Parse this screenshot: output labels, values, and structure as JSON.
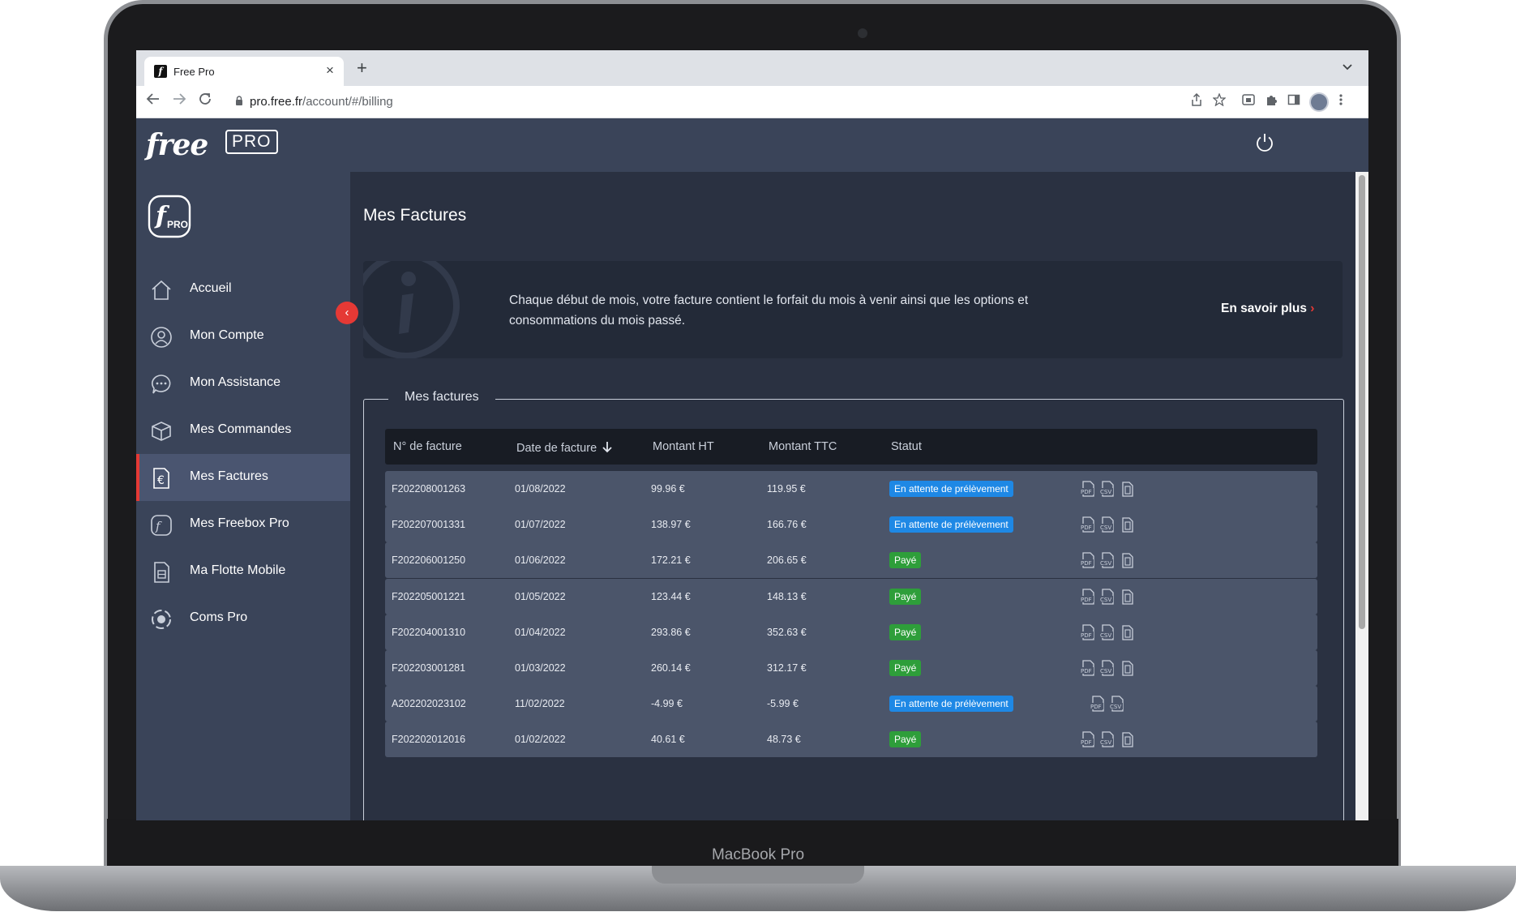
{
  "device": {
    "model_label": "MacBook Pro"
  },
  "browser": {
    "tab_title": "Free Pro",
    "tab_close": "×",
    "new_tab": "+",
    "tab_list": "⌄",
    "url_host": "pro.free.fr",
    "url_path": "/account/#/billing"
  },
  "header": {
    "logo_word": "free",
    "logo_badge": "PRO"
  },
  "sidebar": {
    "logo_letter": "f",
    "logo_sub": "PRO",
    "collapse_glyph": "‹",
    "items": [
      {
        "label": "Accueil",
        "icon": "home-icon"
      },
      {
        "label": "Mon Compte",
        "icon": "user-icon"
      },
      {
        "label": "Mon Assistance",
        "icon": "chat-icon"
      },
      {
        "label": "Mes Commandes",
        "icon": "package-icon"
      },
      {
        "label": "Mes Factures",
        "icon": "euro-document-icon",
        "active": true
      },
      {
        "label": "Mes Freebox Pro",
        "icon": "freebox-icon"
      },
      {
        "label": "Ma Flotte Mobile",
        "icon": "sim-card-icon"
      },
      {
        "label": "Coms Pro",
        "icon": "coms-icon"
      }
    ]
  },
  "main": {
    "title": "Mes Factures",
    "info": {
      "text": "Chaque début de mois, votre facture contient le forfait du mois à venir ainsi que les options et consommations du mois passé.",
      "link": "En savoir plus",
      "link_arrow": "›"
    },
    "section_title": "Mes factures",
    "columns": [
      "N° de facture",
      "Date de facture",
      "Montant HT",
      "Montant TTC",
      "Statut"
    ],
    "rows": [
      {
        "number": "F202208001263",
        "date": "01/08/2022",
        "ht": "99.96 €",
        "ttc": "119.95 €",
        "status": "En attente de prélèvement",
        "kind": "pending",
        "files": [
          "PDF",
          "CSV",
          "DOC"
        ]
      },
      {
        "number": "F202207001331",
        "date": "01/07/2022",
        "ht": "138.97 €",
        "ttc": "166.76 €",
        "status": "En attente de prélèvement",
        "kind": "pending",
        "files": [
          "PDF",
          "CSV",
          "DOC"
        ]
      },
      {
        "number": "F202206001250",
        "date": "01/06/2022",
        "ht": "172.21 €",
        "ttc": "206.65 €",
        "status": "Payé",
        "kind": "paid",
        "files": [
          "PDF",
          "CSV",
          "DOC"
        ]
      },
      {
        "number": "F202205001221",
        "date": "01/05/2022",
        "ht": "123.44 €",
        "ttc": "148.13 €",
        "status": "Payé",
        "kind": "paid",
        "files": [
          "PDF",
          "CSV",
          "DOC"
        ]
      },
      {
        "number": "F202204001310",
        "date": "01/04/2022",
        "ht": "293.86 €",
        "ttc": "352.63 €",
        "status": "Payé",
        "kind": "paid",
        "files": [
          "PDF",
          "CSV",
          "DOC"
        ]
      },
      {
        "number": "F202203001281",
        "date": "01/03/2022",
        "ht": "260.14 €",
        "ttc": "312.17 €",
        "status": "Payé",
        "kind": "paid",
        "files": [
          "PDF",
          "CSV",
          "DOC"
        ]
      },
      {
        "number": "A202202023102",
        "date": "11/02/2022",
        "ht": "-4.99 €",
        "ttc": "-5.99 €",
        "status": "En attente de prélèvement",
        "kind": "pending",
        "files": [
          "PDF",
          "CSV"
        ]
      },
      {
        "number": "F202202012016",
        "date": "01/02/2022",
        "ht": "40.61 €",
        "ttc": "48.73 €",
        "status": "Payé",
        "kind": "paid",
        "files": [
          "PDF",
          "CSV",
          "DOC"
        ]
      }
    ]
  },
  "colors": {
    "accent": "#e53935",
    "pending": "#1e88e5",
    "paid": "#2e9e3a",
    "sidebar": "#3a4459",
    "background": "#2a3141"
  }
}
